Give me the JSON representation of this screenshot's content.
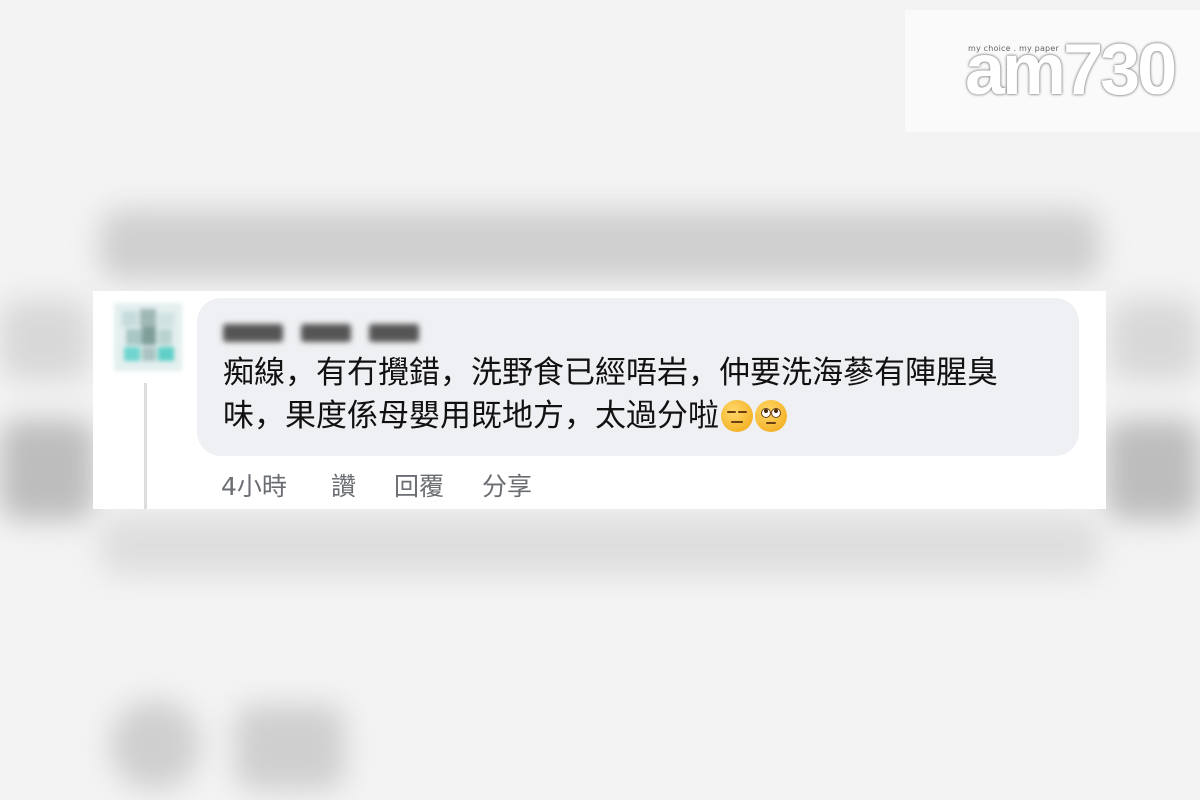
{
  "logo": {
    "tagline": "my choice . my paper",
    "text": "am730"
  },
  "comment": {
    "author": "",
    "text": "痴線，有冇攪錯，洗野食已經唔岩，仲要洗海蔘有陣腥臭味，果度係母嬰用既地方，太過分啦",
    "emojis": [
      "expressionless-face",
      "face-with-rolling-eyes"
    ],
    "time": "4小時",
    "like_label": "讚",
    "reply_label": "回覆",
    "share_label": "分享"
  }
}
